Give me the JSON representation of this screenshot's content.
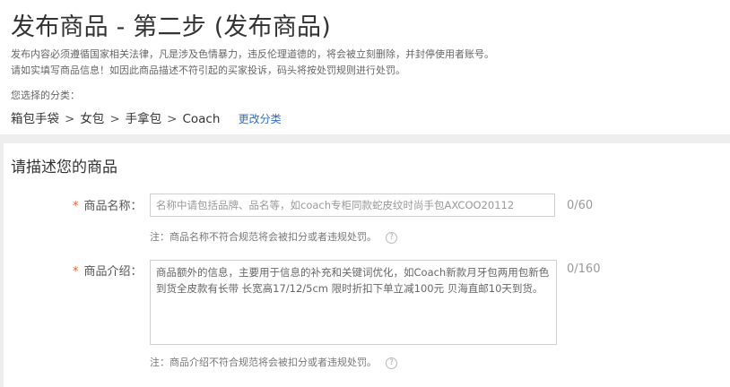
{
  "page": {
    "title": "发布商品 - 第二步 (发布商品)",
    "notice_line1": "发布内容必须遵循国家相关法律，凡是涉及色情暴力，违反伦理道德的，将会被立刻删除，并封停使用者账号。",
    "notice_line2": "请如实填写商品信息！如因此商品描述不符引起的买家投诉，码头将按处罚规则进行处罚。"
  },
  "category": {
    "label": "您选择的分类：",
    "path": [
      "箱包手袋",
      "女包",
      "手拿包",
      "Coach"
    ],
    "separator": ">",
    "change_link": "更改分类"
  },
  "form": {
    "section_title": "请描述您的商品",
    "required_mark": "*",
    "name_field": {
      "label": "商品名称：",
      "placeholder": "名称中请包括品牌、品名等，如coach专柜同款蛇皮纹时尚手包AXCOO20112",
      "counter": "0/60",
      "note": "注：商品名称不符合规范将会被扣分或者违规处罚。",
      "help_icon": "?"
    },
    "desc_field": {
      "label": "商品介绍：",
      "placeholder": "商品额外的信息，主要用于信息的补充和关键词优化，如Coach新款月牙包两用包新色到货全皮款有长带 长宽高17/12/5cm 限时折扣下单立减100元 贝海直邮10天到货。",
      "counter": "0/160",
      "note": "注：商品介绍不符合规范将会被扣分或者违规处罚。",
      "help_icon": "?"
    }
  },
  "colors": {
    "required": "#e8602c",
    "link": "#2c6fcc",
    "band": "#eeeeee",
    "border": "#cfcfcf"
  }
}
